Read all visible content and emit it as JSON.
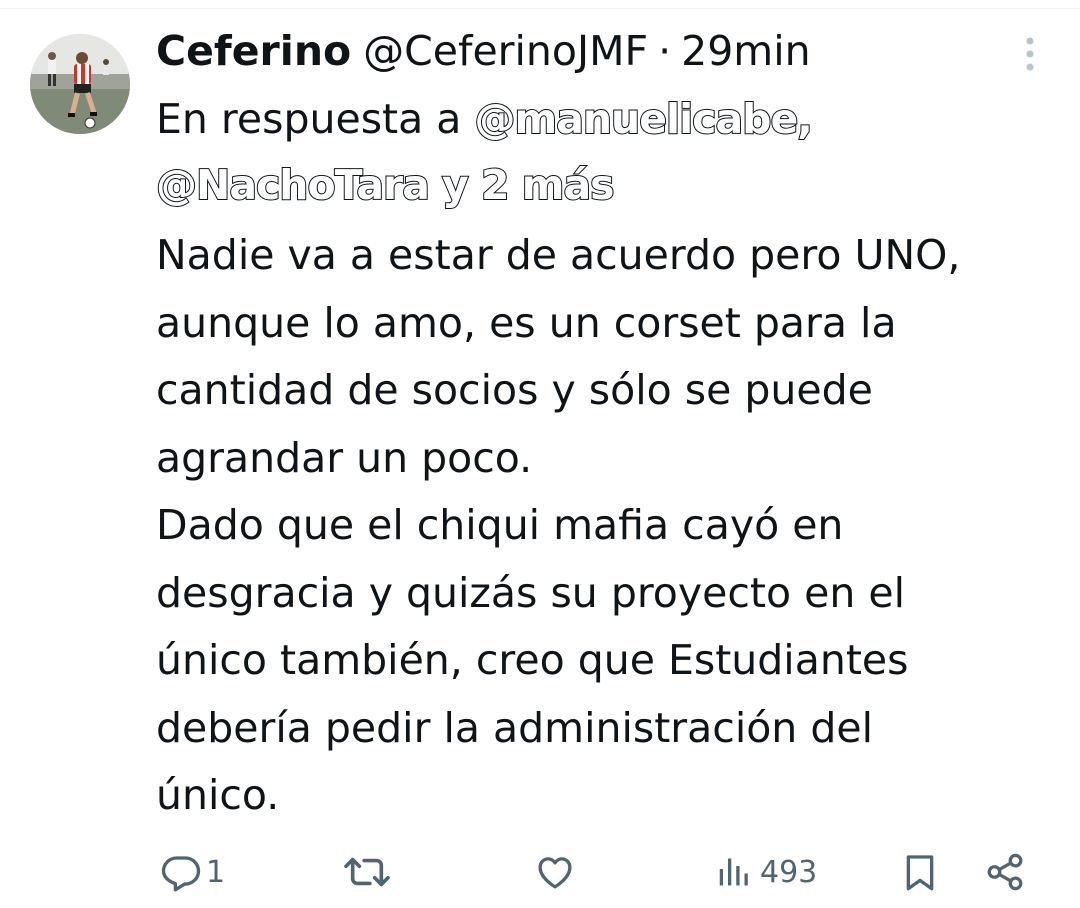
{
  "tweet": {
    "display_name": "Ceferino",
    "handle": "@CeferinoJMF",
    "separator": "·",
    "time": "29min",
    "reply_prefix": "En respuesta a",
    "reply_mention_1": "@manuelicabe,",
    "reply_mention_2": "@NachoTara",
    "reply_more": "y 2 más",
    "text": "Nadie va a estar de acuerdo pero UNO,\naunque lo amo, es un corset para la\ncantidad de socios y sólo se puede\nagrandar un poco.\nDado que el chiqui mafia cayó en\ndesgracia y quizás su proyecto en el\núnico también, creo que Estudiantes\ndebería pedir la administración del\núnico."
  },
  "actions": {
    "replies": "1",
    "retweets": "",
    "likes": "",
    "views": "493"
  },
  "icons": {
    "more": "more-vertical-icon",
    "reply": "reply-icon",
    "retweet": "retweet-icon",
    "like": "heart-icon",
    "views": "views-bar-chart-icon",
    "bookmark": "bookmark-icon",
    "share": "share-icon"
  },
  "colors": {
    "text": "#0f1419",
    "secondary": "#536471",
    "divider": "#eff3f4",
    "more_dots": "#b9c4cc"
  }
}
